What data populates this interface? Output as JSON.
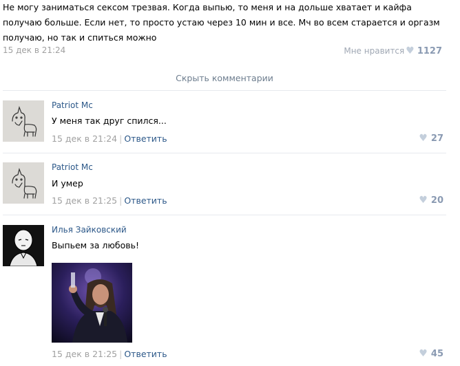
{
  "post": {
    "text": "Не могу заниматься сексом трезвая. Когда выпью, то меня и на дольше хватает и кайфа получаю больше. Если нет, то просто устаю через 10 мин и все. Мч во всем старается и оргазм получаю, но так и спиться можно",
    "date": "15 дек в 21:24",
    "like_label": "Мне нравится",
    "like_count": "1127"
  },
  "hide_comments": "Скрыть комментарии",
  "comments": [
    {
      "author": "Patriot Mc",
      "text": "У меня так друг спился...",
      "date": "15 дек в 21:24",
      "reply": "Ответить",
      "likes": "27",
      "avatar_icon": "unicorn-sketch-icon"
    },
    {
      "author": "Patriot Mc",
      "text": "И умер",
      "date": "15 дек в 21:25",
      "reply": "Ответить",
      "likes": "20",
      "avatar_icon": "unicorn-sketch-icon"
    },
    {
      "author": "Илья Зайковский",
      "text": "Выпьем за любовь!",
      "date": "15 дек в 21:25",
      "reply": "Ответить",
      "likes": "45",
      "avatar_icon": "bald-hero-icon"
    }
  ]
}
